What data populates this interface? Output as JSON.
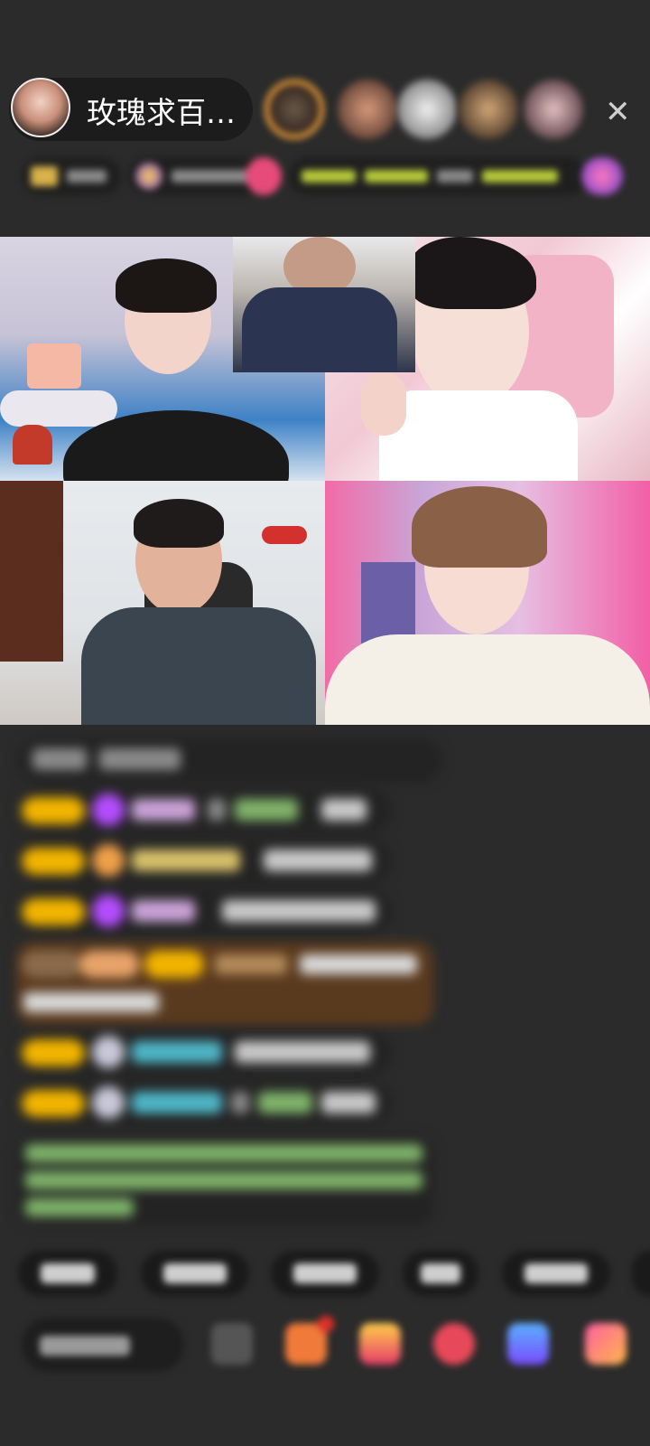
{
  "header": {
    "host_name": "玫瑰求百…",
    "close_icon": "close-icon"
  },
  "colors": {
    "background": "#2b2b2b",
    "level_badge": "#f1b400",
    "gem_purple": "#b44cff",
    "nick_cyan": "#4fb6c8",
    "highlight_msg_bg": "#5a3a1e"
  },
  "icons": {
    "host_avatar": "avatar",
    "viewer": "avatar",
    "gift": "gift-icon",
    "emoji": "emoji-icon"
  }
}
